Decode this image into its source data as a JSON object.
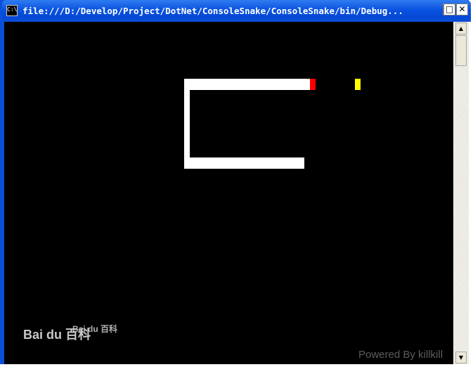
{
  "window": {
    "title": "file:///D:/Develop/Project/DotNet/ConsoleSnake/ConsoleSnake/bin/Debug...",
    "app_icon_text": "C:\\",
    "minimize_label": "_",
    "maximize_label": "□",
    "close_label": "✕"
  },
  "scrollbar": {
    "up_arrow": "▲",
    "down_arrow": "▼"
  },
  "game": {
    "background_color": "#000000",
    "snake_color": "#ffffff",
    "head_color": "#ff0000",
    "food_color": "#ffff00"
  },
  "watermark": {
    "text": "Bai du 百科",
    "small_text": "Bai du 百科"
  },
  "footer": {
    "credit": "Powered By killkill"
  }
}
